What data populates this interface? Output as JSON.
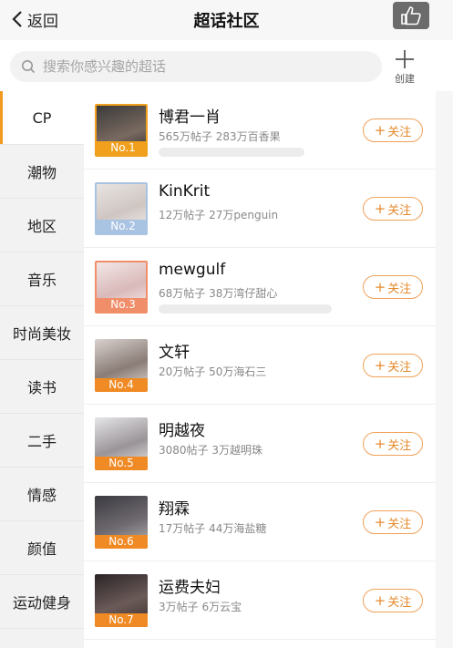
{
  "header": {
    "back_label": "返回",
    "title": "超话社区"
  },
  "search": {
    "placeholder": "搜索你感兴趣的超话",
    "create_label": "创建"
  },
  "sidebar": {
    "items": [
      {
        "label": "CP",
        "active": true
      },
      {
        "label": "潮物"
      },
      {
        "label": "地区"
      },
      {
        "label": "音乐"
      },
      {
        "label": "时尚美妆"
      },
      {
        "label": "读书"
      },
      {
        "label": "二手"
      },
      {
        "label": "情感"
      },
      {
        "label": "颜值"
      },
      {
        "label": "运动健身"
      }
    ]
  },
  "list": {
    "follow_plus": "+",
    "follow_label": "关注",
    "items": [
      {
        "rank": "No.1",
        "name": "博君一肖",
        "meta": "565万帖子 283万百香果",
        "rank_color": "#f0a01c",
        "crown": true
      },
      {
        "rank": "No.2",
        "name": "KinKrit",
        "meta": "12万帖子 27万penguin",
        "rank_color": "#a9c3e2",
        "crown": true
      },
      {
        "rank": "No.3",
        "name": "mewgulf",
        "meta": "68万帖子 38万湾仔甜心",
        "rank_color": "#f08e6a",
        "crown": true
      },
      {
        "rank": "No.4",
        "name": "文轩",
        "meta": "20万帖子 50万海石三",
        "rank_color": "#f08a24",
        "crown": false
      },
      {
        "rank": "No.5",
        "name": "明越夜",
        "meta": "3080帖子 3万越明珠",
        "rank_color": "#f08a24",
        "crown": false
      },
      {
        "rank": "No.6",
        "name": "翔霖",
        "meta": "17万帖子 44万海盐糖",
        "rank_color": "#f08a24",
        "crown": false
      },
      {
        "rank": "No.7",
        "name": "运费夫妇",
        "meta": "3万帖子 6万云宝",
        "rank_color": "#f08a24",
        "crown": false
      }
    ]
  }
}
